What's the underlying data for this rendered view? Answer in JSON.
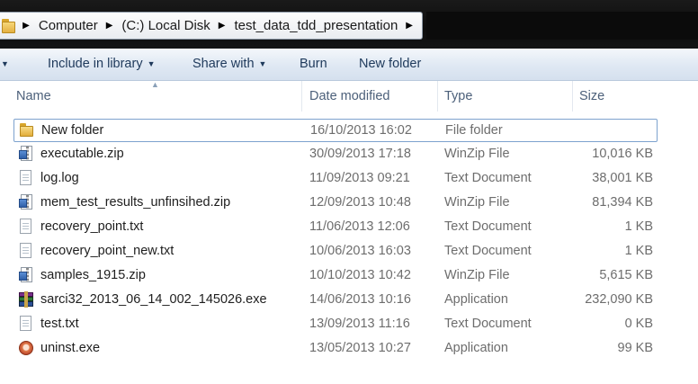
{
  "address_bar": {
    "breadcrumbs": [
      "Computer",
      "(C:) Local Disk",
      "test_data_tdd_presentation"
    ]
  },
  "toolbar": {
    "items": [
      {
        "label": "Include in library",
        "dropdown": true
      },
      {
        "label": "Share with",
        "dropdown": true
      },
      {
        "label": "Burn",
        "dropdown": false
      },
      {
        "label": "New folder",
        "dropdown": false
      }
    ]
  },
  "columns": {
    "name": "Name",
    "date": "Date modified",
    "type": "Type",
    "size": "Size"
  },
  "files": [
    {
      "name": "New folder",
      "date": "16/10/2013 16:02",
      "type": "File folder",
      "size": "",
      "icon": "folder-icon"
    },
    {
      "name": "executable.zip",
      "date": "30/09/2013 17:18",
      "type": "WinZip File",
      "size": "10,016 KB",
      "icon": "zip-file-icon"
    },
    {
      "name": "log.log",
      "date": "11/09/2013 09:21",
      "type": "Text Document",
      "size": "38,001 KB",
      "icon": "text-document-icon"
    },
    {
      "name": "mem_test_results_unfinsihed.zip",
      "date": "12/09/2013 10:48",
      "type": "WinZip File",
      "size": "81,394 KB",
      "icon": "zip-file-icon"
    },
    {
      "name": "recovery_point.txt",
      "date": "11/06/2013 12:06",
      "type": "Text Document",
      "size": "1 KB",
      "icon": "text-document-icon"
    },
    {
      "name": "recovery_point_new.txt",
      "date": "10/06/2013 16:03",
      "type": "Text Document",
      "size": "1 KB",
      "icon": "text-document-icon"
    },
    {
      "name": "samples_1915.zip",
      "date": "10/10/2013 10:42",
      "type": "WinZip File",
      "size": "5,615 KB",
      "icon": "zip-file-icon"
    },
    {
      "name": "sarci32_2013_06_14_002_145026.exe",
      "date": "14/06/2013 10:16",
      "type": "Application",
      "size": "232,090 KB",
      "icon": "winrar-archive-icon"
    },
    {
      "name": "test.txt",
      "date": "13/09/2013 11:16",
      "type": "Text Document",
      "size": "0 KB",
      "icon": "text-document-icon"
    },
    {
      "name": "uninst.exe",
      "date": "13/05/2013 10:27",
      "type": "Application",
      "size": "99 KB",
      "icon": "uninstaller-icon"
    }
  ]
}
